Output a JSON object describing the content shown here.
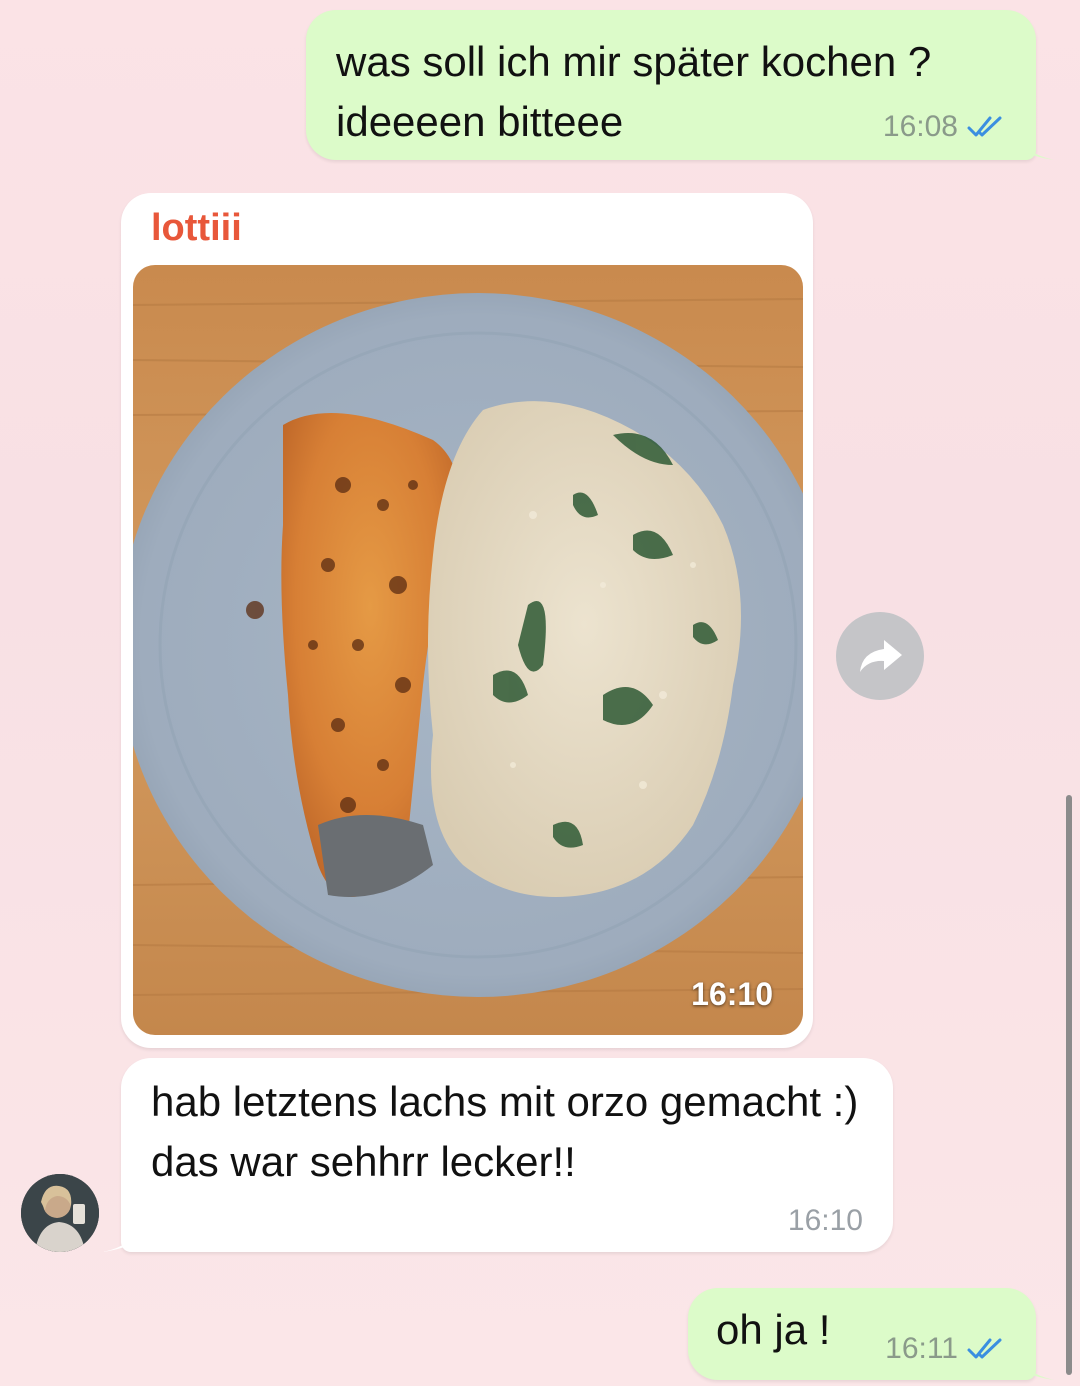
{
  "messages": {
    "m1": {
      "text": "was soll ich mir später kochen ? ideeeen bitteee",
      "time": "16:08",
      "status": "read"
    },
    "m2": {
      "sender": "lottiii",
      "time": "16:10",
      "image": "photo of baked salmon fillet with creamy spinach orzo on a blue plate on a wooden table"
    },
    "m3": {
      "text": "hab letztens lachs mit orzo gemacht :) das war sehhrr lecker!!",
      "time": "16:10"
    },
    "m4": {
      "text": "oh ja !",
      "time": "16:11",
      "status": "read"
    }
  },
  "icons": {
    "forward": "forward-arrow-icon",
    "read_receipt": "double-check-icon"
  },
  "colors": {
    "outgoing_bubble": "#dcfbc9",
    "incoming_bubble": "#ffffff",
    "sender_name": "#e8573a",
    "read_ticks": "#3b8fe0",
    "background": "#fbe3e6"
  }
}
